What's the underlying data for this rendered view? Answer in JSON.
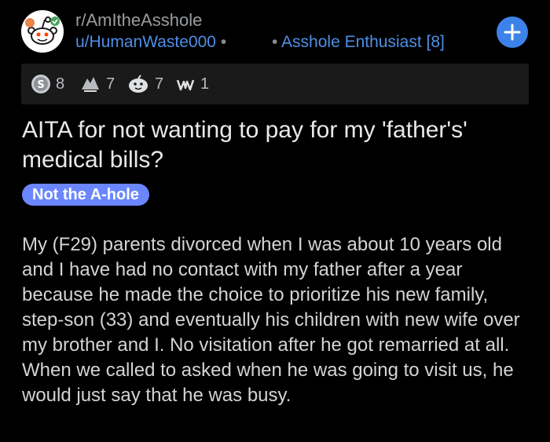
{
  "post": {
    "subreddit": "r/AmItheAsshole",
    "author": "u/HumanWaste000",
    "separator": "•",
    "user_flair": "Asshole Enthusiast [8]",
    "awards": [
      {
        "icon": "silver-award-icon",
        "count": "8"
      },
      {
        "icon": "helpful-award-icon",
        "count": "7"
      },
      {
        "icon": "wholesome-award-icon",
        "count": "7"
      },
      {
        "icon": "hands-award-icon",
        "count": "1"
      }
    ],
    "title": "AITA for not wanting to pay for my 'father's' medical bills?",
    "flair": "Not the A-hole",
    "body": "My (F29) parents divorced when I was about 10 years old and I have had no contact with my father after a year because he made the choice to prioritize his new family, step-son (33) and eventually his children with new wife over my brother and I. No visitation after he got remarried at all.  When we called to asked when he was going to visit us, he would just say that he was busy."
  },
  "colors": {
    "background": "#000000",
    "link": "#4f8fe6",
    "join_button": "#3d82e8",
    "flair_bg": "#6b87ff",
    "award_bar": "#1a1a1b"
  }
}
